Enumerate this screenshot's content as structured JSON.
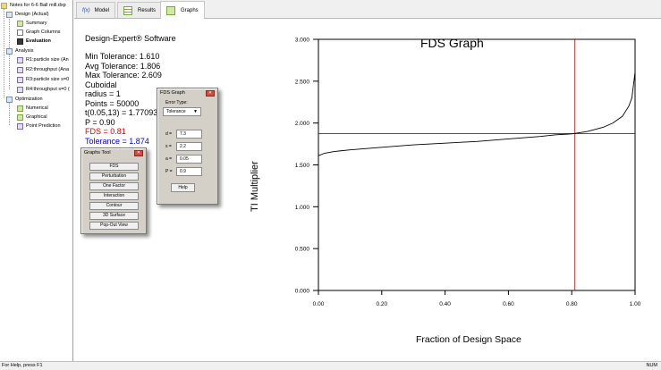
{
  "tree": {
    "items": [
      {
        "label": "Notes for 6-6 Ball mill.dxp",
        "icon": "folder-icon",
        "bold": false
      },
      {
        "label": "Design (Actual)",
        "icon": "design-icon",
        "bold": false
      },
      {
        "label": "Summary",
        "icon": "summary-icon",
        "bold": false
      },
      {
        "label": "Graph Columns",
        "icon": "graph-columns-icon",
        "bold": false
      },
      {
        "label": "Evaluation",
        "icon": "evaluation-icon",
        "bold": true
      },
      {
        "label": "Analysis",
        "icon": "analysis-icon",
        "bold": false
      },
      {
        "label": "R1:particle size (An",
        "icon": "response-icon",
        "bold": false
      },
      {
        "label": "R2:throughput (Ana",
        "icon": "response-icon",
        "bold": false
      },
      {
        "label": "R3:particle size s=0",
        "icon": "response-icon",
        "bold": false
      },
      {
        "label": "R4:throughput s=0 (",
        "icon": "response-icon",
        "bold": false
      },
      {
        "label": "Optimization",
        "icon": "optimization-icon",
        "bold": false
      },
      {
        "label": "Numerical",
        "icon": "numerical-icon",
        "bold": false
      },
      {
        "label": "Graphical",
        "icon": "graphical-icon",
        "bold": false
      },
      {
        "label": "Point Prediction",
        "icon": "point-prediction-icon",
        "bold": false
      }
    ]
  },
  "tabs": [
    {
      "label": "Model",
      "icon": "fx-icon",
      "icon_text": "f(x)"
    },
    {
      "label": "Results",
      "icon": "results-icon"
    },
    {
      "label": "Graphs",
      "icon": "graphs-icon"
    }
  ],
  "main": {
    "software": "Design-Expert® Software",
    "lines": [
      {
        "text": "Min Tolerance: 1.610",
        "color": "#000000"
      },
      {
        "text": "Avg Tolerance: 1.806",
        "color": "#000000"
      },
      {
        "text": "Max Tolerance: 2.609",
        "color": "#000000"
      },
      {
        "text": "Cuboidal",
        "color": "#000000"
      },
      {
        "text": "radius = 1",
        "color": "#000000"
      },
      {
        "text": "Points = 50000",
        "color": "#000000"
      },
      {
        "text": "t(0.05,13) = 1.77093",
        "color": "#000000"
      },
      {
        "text": "P = 0.90",
        "color": "#000000"
      },
      {
        "text": "FDS = 0.81",
        "color": "#e00000"
      },
      {
        "text": "Tolerance = 1.874",
        "color": "#0000e0"
      }
    ]
  },
  "graphs_tool": {
    "title": "Graphs Tool",
    "buttons": [
      "FDS",
      "Perturbation",
      "One Factor",
      "Interaction",
      "Contour",
      "3D Surface",
      "Pop-Out View"
    ]
  },
  "fds_tool": {
    "title": "FDS Graph",
    "error_type_label": "Error Type:",
    "error_type_value": "Tolerance",
    "fields": [
      {
        "label": "d =",
        "value": "7.3"
      },
      {
        "label": "s =",
        "value": "2.2"
      },
      {
        "label": "a =",
        "value": "0.05"
      },
      {
        "label": "P =",
        "value": "0.9"
      }
    ],
    "help_label": "Help"
  },
  "chart_data": {
    "type": "line",
    "title": "FDS Graph",
    "xlabel": "Fraction of Design Space",
    "ylabel": "TI Multiplier",
    "xlim": [
      0,
      1
    ],
    "ylim": [
      0,
      3
    ],
    "xticks": [
      "0.00",
      "0.20",
      "0.40",
      "0.60",
      "0.80",
      "1.00"
    ],
    "yticks": [
      "0.000",
      "0.500",
      "1.000",
      "1.500",
      "2.000",
      "2.500",
      "3.000"
    ],
    "series": [
      {
        "x": [
          0,
          0.02,
          0.05,
          0.1,
          0.2,
          0.3,
          0.4,
          0.5,
          0.6,
          0.7,
          0.75,
          0.8,
          0.85,
          0.9,
          0.93,
          0.96,
          0.98,
          0.99,
          1.0
        ],
        "y": [
          1.61,
          1.64,
          1.66,
          1.68,
          1.71,
          1.74,
          1.76,
          1.78,
          1.81,
          1.84,
          1.86,
          1.87,
          1.9,
          1.95,
          2.0,
          2.08,
          2.2,
          2.3,
          2.609
        ],
        "color": "#000000"
      }
    ],
    "reference_lines": [
      {
        "axis": "y",
        "value": 1.874,
        "color": "#0000e0"
      },
      {
        "axis": "x",
        "value": 0.81,
        "color": "#c00000"
      }
    ],
    "grid": false
  },
  "status": {
    "left": "For Help, press F1",
    "right": "NUM"
  }
}
